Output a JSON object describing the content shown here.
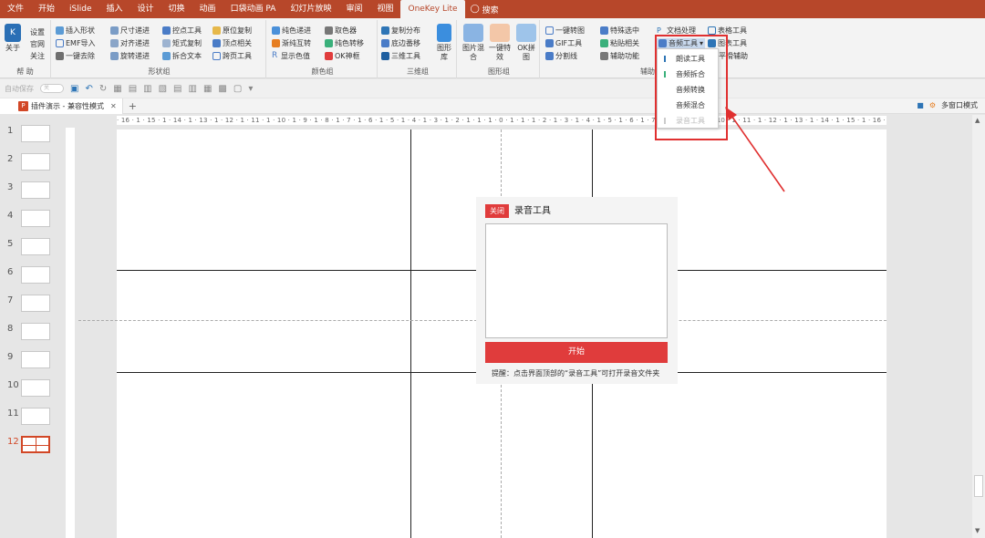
{
  "tabs": [
    "文件",
    "开始",
    "iSlide",
    "插入",
    "设计",
    "切换",
    "动画",
    "口袋动画 PA",
    "幻灯片放映",
    "审阅",
    "视图",
    "OneKey Lite"
  ],
  "search_label": "搜索",
  "ribbon": {
    "about": {
      "about": "关于",
      "settings": "设置",
      "website": "官网",
      "follow": "关注",
      "group": "帮 助"
    },
    "shape": {
      "items": [
        "插入形状",
        "尺寸递进",
        "控点工具",
        "原位复制",
        "EMF导入",
        "对齐递进",
        "矩式复制",
        "顶点相关",
        "一键去除",
        "旋转递进",
        "拆合文本",
        "跨页工具"
      ],
      "group": "形状组"
    },
    "color": {
      "items": [
        "纯色递进",
        "取色器",
        "渐纯互转",
        "纯色转移",
        "显示色值",
        "OK神框"
      ],
      "group": "颜色组"
    },
    "threed": {
      "items": [
        "复制分布",
        "底边番移",
        "三维工具"
      ],
      "shape_lib": "图形库",
      "group": "三维组"
    },
    "image": {
      "items": [
        "图片混合",
        "一键特效",
        "OK拼图"
      ],
      "group": "图形组"
    },
    "assist": {
      "items": [
        "一键转图",
        "GIF工具",
        "分割线",
        "特殊选中",
        "粘贴相关",
        "辅助功能",
        "文档处理",
        "音频工具",
        "表格工具",
        "图表工具",
        "平滑辅助"
      ],
      "group": "辅助组"
    }
  },
  "audio_menu": {
    "items": [
      "朗读工具",
      "音频拆合",
      "音频转换",
      "音频混合",
      "录音工具"
    ]
  },
  "qat": {
    "autosave": "自动保存",
    "toggle": "关"
  },
  "doc": {
    "tab": "插件演示 - 兼容性模式",
    "multi_window": "多窗口模式"
  },
  "slides": [
    "1",
    "2",
    "3",
    "4",
    "5",
    "6",
    "7",
    "8",
    "9",
    "10",
    "11",
    "12"
  ],
  "ruler": "· 16 · 1 · 15 · 1 · 14 · 1 · 13 · 1 · 12 · 1 · 11 · 1 · 10 · 1 · 9 · 1 · 8 · 1 · 7 · 1 · 6 · 1 · 5 · 1 · 4 · 1 · 3 · 1 · 2 · 1 · 1 · 1 · 0 · 1 · 1 · 1 · 2 · 1 · 3 · 1 · 4 · 1 · 5 · 1 · 6 · 1 · 7 · 1 · 8 · 1 · 9 · 1 · 10 · 1 · 11 · 1 · 12 · 1 · 13 · 1 · 14 · 1 · 15 · 1 · 16 ·",
  "dialog": {
    "close": "关闭",
    "title": "录音工具",
    "start": "开始",
    "tip": "提醒：点击界面顶部的“录音工具”可打开录音文件夹"
  },
  "colors": {
    "brand": "#b7472a",
    "accent_red": "#e03c3c"
  }
}
